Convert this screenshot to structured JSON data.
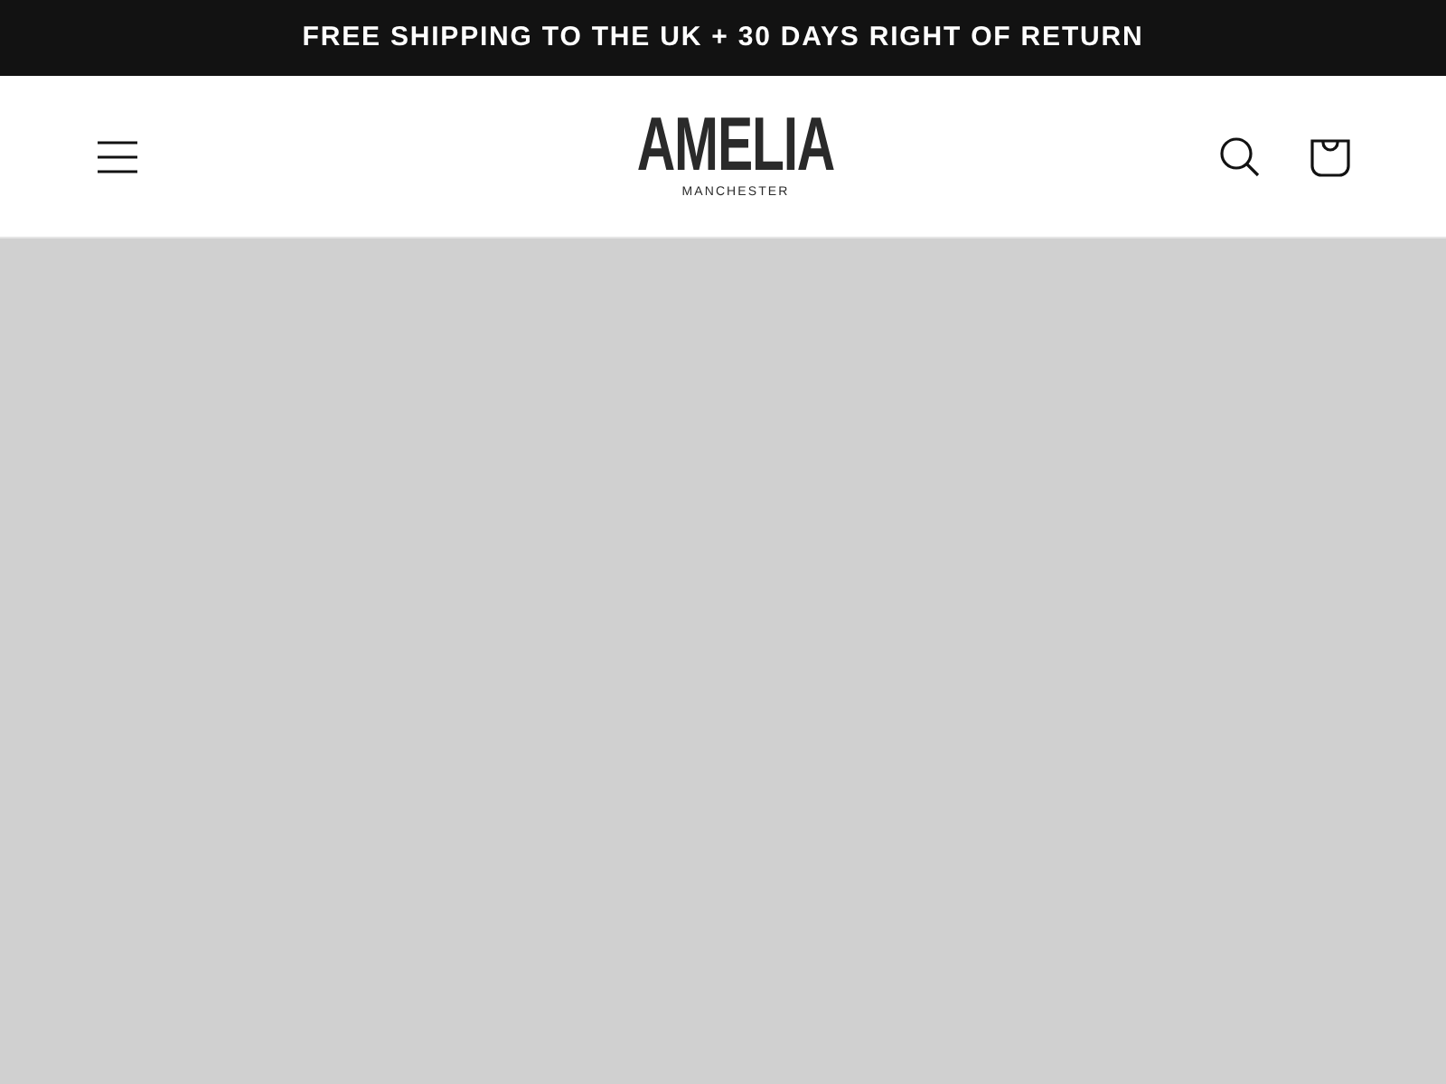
{
  "announcement": "FREE SHIPPING TO THE UK + 30 DAYS RIGHT OF RETURN",
  "logo": {
    "name": "AMELIA",
    "tagline": "MANCHESTER"
  },
  "hero": {
    "kind": "placeholder"
  }
}
